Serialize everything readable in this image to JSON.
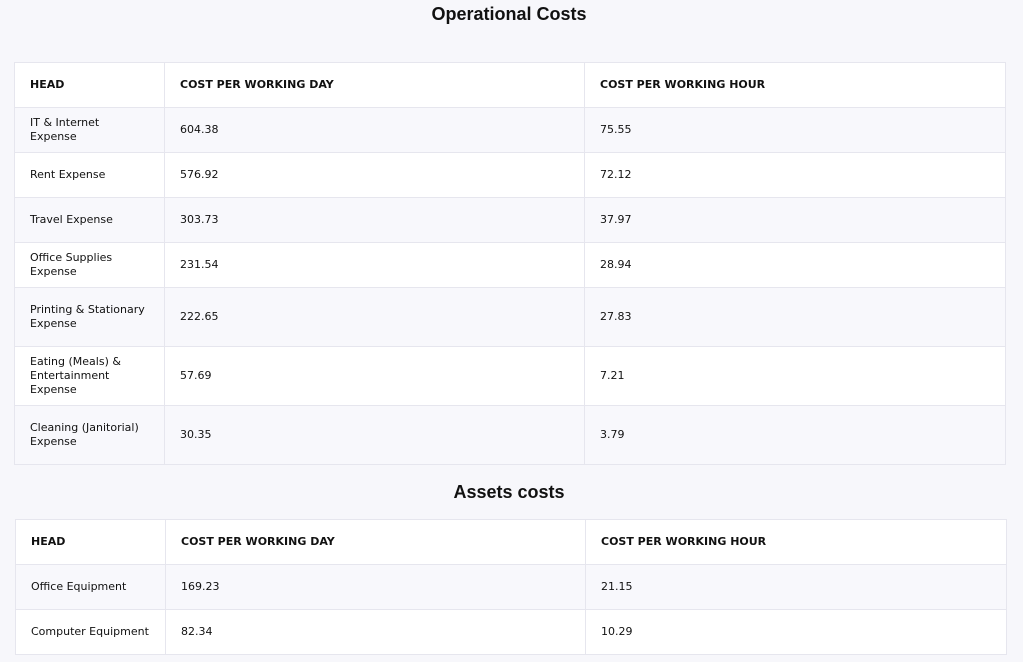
{
  "operational": {
    "title": "Operational Costs",
    "headers": [
      "HEAD",
      "COST PER WORKING DAY",
      "COST PER WORKING HOUR"
    ],
    "rows": [
      {
        "head": "IT & Internet Expense",
        "day": "604.38",
        "hour": "75.55"
      },
      {
        "head": "Rent Expense",
        "day": "576.92",
        "hour": "72.12"
      },
      {
        "head": "Travel Expense",
        "day": "303.73",
        "hour": "37.97"
      },
      {
        "head": "Office Supplies Expense",
        "day": "231.54",
        "hour": "28.94"
      },
      {
        "head": "Printing & Stationary Expense",
        "day": "222.65",
        "hour": "27.83"
      },
      {
        "head": "Eating (Meals) & Entertainment Expense",
        "day": "57.69",
        "hour": "7.21"
      },
      {
        "head": "Cleaning (Janitorial) Expense",
        "day": "30.35",
        "hour": "3.79"
      }
    ]
  },
  "assets": {
    "title": "Assets costs",
    "headers": [
      "HEAD",
      "COST PER WORKING DAY",
      "COST PER WORKING HOUR"
    ],
    "rows": [
      {
        "head": "Office Equipment",
        "day": "169.23",
        "hour": "21.15"
      },
      {
        "head": "Computer Equipment",
        "day": "82.34",
        "hour": "10.29"
      }
    ]
  }
}
